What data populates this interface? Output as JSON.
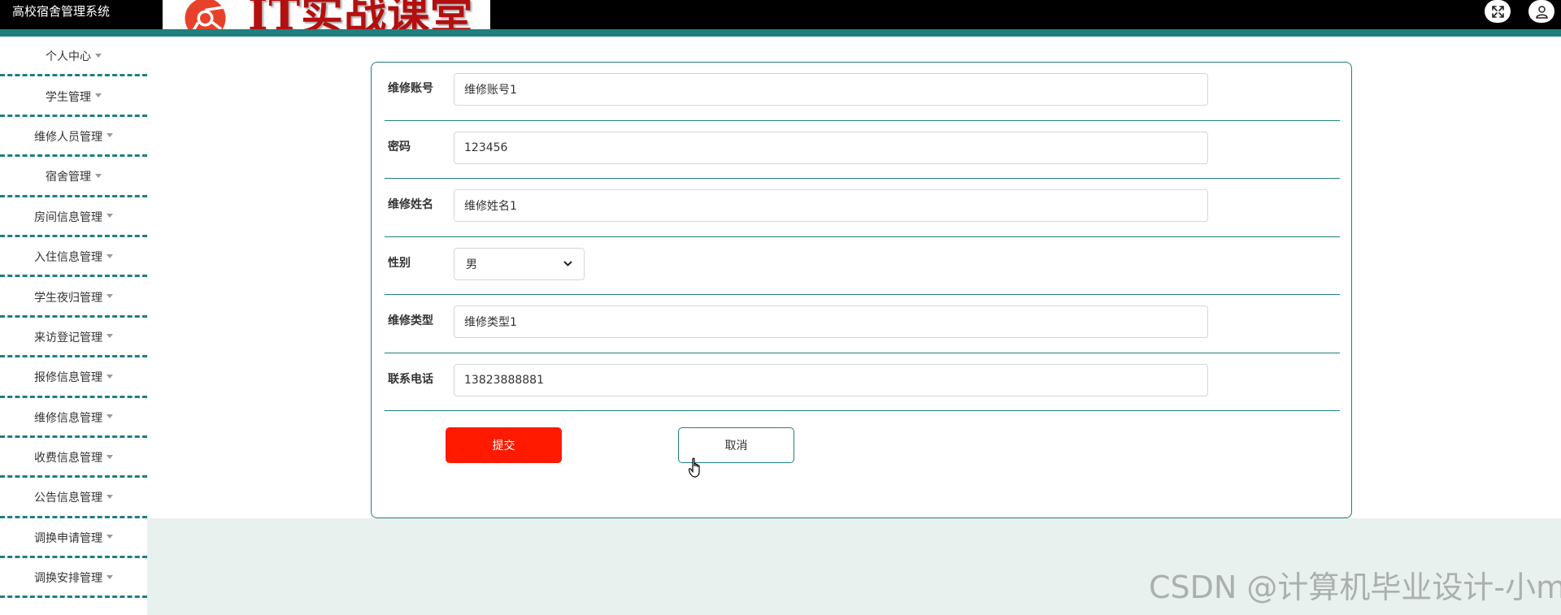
{
  "header": {
    "app_title": "高校宿舍管理系统",
    "brand_text": "IT实战课堂",
    "fullscreen_icon": "expand-icon",
    "user_icon": "user-icon"
  },
  "sidebar": {
    "items": [
      {
        "label": "个人中心"
      },
      {
        "label": "学生管理"
      },
      {
        "label": "维修人员管理"
      },
      {
        "label": "宿舍管理"
      },
      {
        "label": "房间信息管理"
      },
      {
        "label": "入住信息管理"
      },
      {
        "label": "学生夜归管理"
      },
      {
        "label": "来访登记管理"
      },
      {
        "label": "报修信息管理"
      },
      {
        "label": "维修信息管理"
      },
      {
        "label": "收费信息管理"
      },
      {
        "label": "公告信息管理"
      },
      {
        "label": "调换申请管理"
      },
      {
        "label": "调换安排管理"
      }
    ]
  },
  "form": {
    "fields": [
      {
        "label": "维修账号",
        "value": "维修账号1"
      },
      {
        "label": "密码",
        "value": "123456"
      },
      {
        "label": "维修姓名",
        "value": "维修姓名1"
      },
      {
        "label": "性别",
        "value": "男"
      },
      {
        "label": "维修类型",
        "value": "维修类型1"
      },
      {
        "label": "联系电话",
        "value": "13823888881"
      }
    ],
    "submit_label": "提交",
    "cancel_label": "取消"
  },
  "watermark": "CSDN @计算机毕业设计-小ma",
  "colors": {
    "accent": "#1e7f7e",
    "submit": "#ff1a00",
    "brand_text": "#b40f0f",
    "content_bg": "#e8f1ee"
  }
}
